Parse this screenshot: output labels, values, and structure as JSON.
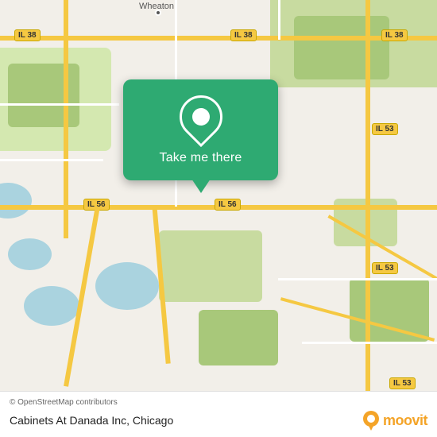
{
  "map": {
    "attribution": "© OpenStreetMap contributors",
    "background_color": "#f2efe9",
    "city_label": "Wheaton",
    "road_labels": [
      "IL 38",
      "IL 38",
      "IL 38",
      "IL 56",
      "IL 56",
      "IL 53",
      "IL 53",
      "IL 53"
    ],
    "zoom_area": "Wheaton, Illinois"
  },
  "popup": {
    "button_label": "Take me there",
    "background_color": "#2eaa72"
  },
  "bottom_bar": {
    "attribution": "© OpenStreetMap contributors",
    "place_name": "Cabinets At Danada Inc",
    "city": "Chicago",
    "place_display": "Cabinets At Danada Inc, Chicago",
    "moovit_text": "moovit"
  }
}
